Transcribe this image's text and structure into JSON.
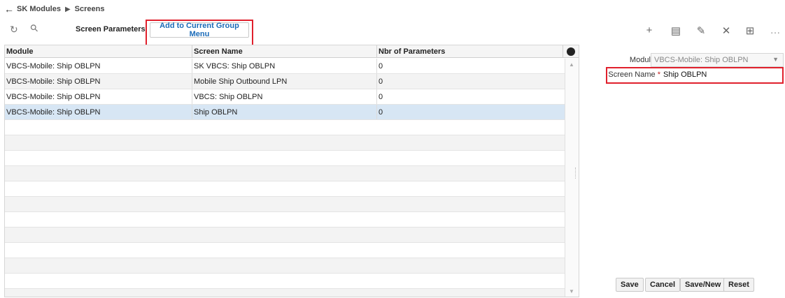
{
  "breadcrumb": {
    "back_icon": "←",
    "items": [
      "SK Modules",
      "Screens"
    ],
    "separator": "▶"
  },
  "toolbar": {
    "refresh_icon": "↻",
    "search_icon": "⚲",
    "title": "Screen Parameters",
    "add_group_label": "Add to Current Group Menu",
    "right_icons": {
      "add": "+",
      "details": "▤",
      "edit": "✎",
      "delete": "✕",
      "export": "⊞",
      "more": "…"
    }
  },
  "grid": {
    "columns": [
      "Module",
      "Screen Name",
      "Nbr of Parameters"
    ],
    "gear_icon": "⚙",
    "rows": [
      {
        "module": "VBCS-Mobile: Ship OBLPN",
        "screen_name": "SK VBCS: Ship OBLPN",
        "nbr_params": "0"
      },
      {
        "module": "VBCS-Mobile: Ship OBLPN",
        "screen_name": "Mobile Ship Outbound LPN",
        "nbr_params": "0"
      },
      {
        "module": "VBCS-Mobile: Ship OBLPN",
        "screen_name": "VBCS: Ship OBLPN",
        "nbr_params": "0"
      },
      {
        "module": "VBCS-Mobile: Ship OBLPN",
        "screen_name": "Ship OBLPN",
        "nbr_params": "0"
      }
    ],
    "selected_index": 3
  },
  "form": {
    "module_label": "Module",
    "module_value": "VBCS-Mobile: Ship OBLPN",
    "screen_name_label": "Screen Name",
    "required_mark": "*",
    "screen_name_value": "Ship OBLPN",
    "buttons": {
      "save": "Save",
      "cancel": "Cancel",
      "save_new": "Save/New",
      "reset": "Reset"
    }
  },
  "colors": {
    "highlight": "#e0202c",
    "link": "#1b6bb8",
    "selected_row": "#d7e6f4"
  }
}
